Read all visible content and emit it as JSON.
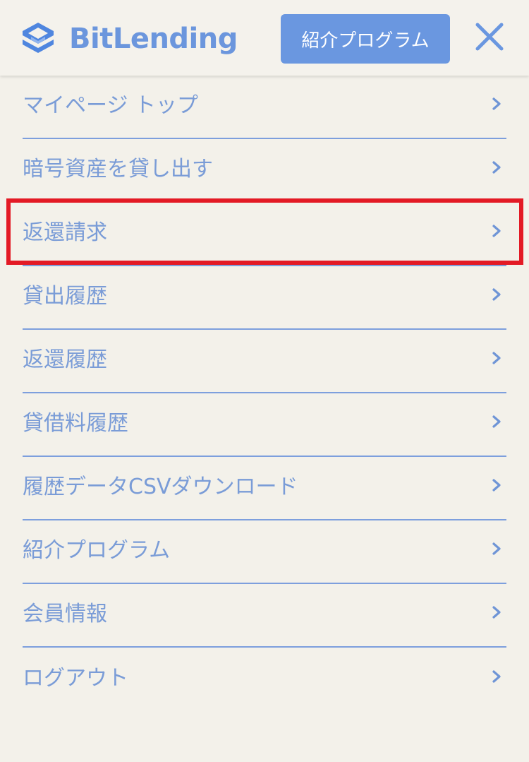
{
  "header": {
    "logo": {
      "text_bit": "Bit",
      "text_lending": "Lending",
      "icon": "bitlending-logo-icon",
      "colors": {
        "bit": "#6b96dd",
        "lending": "#6b96dd",
        "icon_primary": "#4f86df",
        "icon_secondary": "#8fb4ee"
      }
    },
    "referral_button_label": "紹介プログラム",
    "close_icon": "close-icon"
  },
  "menu": {
    "items": [
      {
        "label": "マイページ トップ"
      },
      {
        "label": "暗号資産を貸し出す"
      },
      {
        "label": "返還請求",
        "highlighted": true
      },
      {
        "label": "貸出履歴"
      },
      {
        "label": "返還履歴"
      },
      {
        "label": "貸借料履歴"
      },
      {
        "label": "履歴データCSVダウンロード"
      },
      {
        "label": "紹介プログラム"
      },
      {
        "label": "会員情報"
      },
      {
        "label": "ログアウト"
      }
    ],
    "chevron_icon": "chevron-right-icon"
  },
  "colors": {
    "background": "#f3f1ea",
    "accent": "#6a97e0",
    "menu_text": "#7a9cd7",
    "divider": "#7d9fdd",
    "highlight": "#e31a25"
  }
}
